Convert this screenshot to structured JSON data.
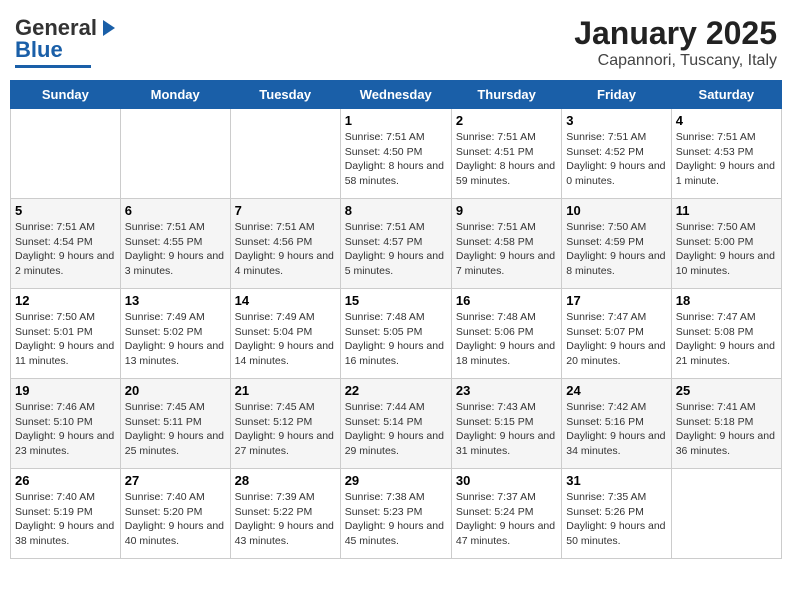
{
  "header": {
    "logo_general": "General",
    "logo_blue": "Blue",
    "title": "January 2025",
    "subtitle": "Capannori, Tuscany, Italy"
  },
  "days_of_week": [
    "Sunday",
    "Monday",
    "Tuesday",
    "Wednesday",
    "Thursday",
    "Friday",
    "Saturday"
  ],
  "weeks": [
    [
      {
        "day": "",
        "sunrise": "",
        "sunset": "",
        "daylight": ""
      },
      {
        "day": "",
        "sunrise": "",
        "sunset": "",
        "daylight": ""
      },
      {
        "day": "",
        "sunrise": "",
        "sunset": "",
        "daylight": ""
      },
      {
        "day": "1",
        "sunrise": "Sunrise: 7:51 AM",
        "sunset": "Sunset: 4:50 PM",
        "daylight": "Daylight: 8 hours and 58 minutes."
      },
      {
        "day": "2",
        "sunrise": "Sunrise: 7:51 AM",
        "sunset": "Sunset: 4:51 PM",
        "daylight": "Daylight: 8 hours and 59 minutes."
      },
      {
        "day": "3",
        "sunrise": "Sunrise: 7:51 AM",
        "sunset": "Sunset: 4:52 PM",
        "daylight": "Daylight: 9 hours and 0 minutes."
      },
      {
        "day": "4",
        "sunrise": "Sunrise: 7:51 AM",
        "sunset": "Sunset: 4:53 PM",
        "daylight": "Daylight: 9 hours and 1 minute."
      }
    ],
    [
      {
        "day": "5",
        "sunrise": "Sunrise: 7:51 AM",
        "sunset": "Sunset: 4:54 PM",
        "daylight": "Daylight: 9 hours and 2 minutes."
      },
      {
        "day": "6",
        "sunrise": "Sunrise: 7:51 AM",
        "sunset": "Sunset: 4:55 PM",
        "daylight": "Daylight: 9 hours and 3 minutes."
      },
      {
        "day": "7",
        "sunrise": "Sunrise: 7:51 AM",
        "sunset": "Sunset: 4:56 PM",
        "daylight": "Daylight: 9 hours and 4 minutes."
      },
      {
        "day": "8",
        "sunrise": "Sunrise: 7:51 AM",
        "sunset": "Sunset: 4:57 PM",
        "daylight": "Daylight: 9 hours and 5 minutes."
      },
      {
        "day": "9",
        "sunrise": "Sunrise: 7:51 AM",
        "sunset": "Sunset: 4:58 PM",
        "daylight": "Daylight: 9 hours and 7 minutes."
      },
      {
        "day": "10",
        "sunrise": "Sunrise: 7:50 AM",
        "sunset": "Sunset: 4:59 PM",
        "daylight": "Daylight: 9 hours and 8 minutes."
      },
      {
        "day": "11",
        "sunrise": "Sunrise: 7:50 AM",
        "sunset": "Sunset: 5:00 PM",
        "daylight": "Daylight: 9 hours and 10 minutes."
      }
    ],
    [
      {
        "day": "12",
        "sunrise": "Sunrise: 7:50 AM",
        "sunset": "Sunset: 5:01 PM",
        "daylight": "Daylight: 9 hours and 11 minutes."
      },
      {
        "day": "13",
        "sunrise": "Sunrise: 7:49 AM",
        "sunset": "Sunset: 5:02 PM",
        "daylight": "Daylight: 9 hours and 13 minutes."
      },
      {
        "day": "14",
        "sunrise": "Sunrise: 7:49 AM",
        "sunset": "Sunset: 5:04 PM",
        "daylight": "Daylight: 9 hours and 14 minutes."
      },
      {
        "day": "15",
        "sunrise": "Sunrise: 7:48 AM",
        "sunset": "Sunset: 5:05 PM",
        "daylight": "Daylight: 9 hours and 16 minutes."
      },
      {
        "day": "16",
        "sunrise": "Sunrise: 7:48 AM",
        "sunset": "Sunset: 5:06 PM",
        "daylight": "Daylight: 9 hours and 18 minutes."
      },
      {
        "day": "17",
        "sunrise": "Sunrise: 7:47 AM",
        "sunset": "Sunset: 5:07 PM",
        "daylight": "Daylight: 9 hours and 20 minutes."
      },
      {
        "day": "18",
        "sunrise": "Sunrise: 7:47 AM",
        "sunset": "Sunset: 5:08 PM",
        "daylight": "Daylight: 9 hours and 21 minutes."
      }
    ],
    [
      {
        "day": "19",
        "sunrise": "Sunrise: 7:46 AM",
        "sunset": "Sunset: 5:10 PM",
        "daylight": "Daylight: 9 hours and 23 minutes."
      },
      {
        "day": "20",
        "sunrise": "Sunrise: 7:45 AM",
        "sunset": "Sunset: 5:11 PM",
        "daylight": "Daylight: 9 hours and 25 minutes."
      },
      {
        "day": "21",
        "sunrise": "Sunrise: 7:45 AM",
        "sunset": "Sunset: 5:12 PM",
        "daylight": "Daylight: 9 hours and 27 minutes."
      },
      {
        "day": "22",
        "sunrise": "Sunrise: 7:44 AM",
        "sunset": "Sunset: 5:14 PM",
        "daylight": "Daylight: 9 hours and 29 minutes."
      },
      {
        "day": "23",
        "sunrise": "Sunrise: 7:43 AM",
        "sunset": "Sunset: 5:15 PM",
        "daylight": "Daylight: 9 hours and 31 minutes."
      },
      {
        "day": "24",
        "sunrise": "Sunrise: 7:42 AM",
        "sunset": "Sunset: 5:16 PM",
        "daylight": "Daylight: 9 hours and 34 minutes."
      },
      {
        "day": "25",
        "sunrise": "Sunrise: 7:41 AM",
        "sunset": "Sunset: 5:18 PM",
        "daylight": "Daylight: 9 hours and 36 minutes."
      }
    ],
    [
      {
        "day": "26",
        "sunrise": "Sunrise: 7:40 AM",
        "sunset": "Sunset: 5:19 PM",
        "daylight": "Daylight: 9 hours and 38 minutes."
      },
      {
        "day": "27",
        "sunrise": "Sunrise: 7:40 AM",
        "sunset": "Sunset: 5:20 PM",
        "daylight": "Daylight: 9 hours and 40 minutes."
      },
      {
        "day": "28",
        "sunrise": "Sunrise: 7:39 AM",
        "sunset": "Sunset: 5:22 PM",
        "daylight": "Daylight: 9 hours and 43 minutes."
      },
      {
        "day": "29",
        "sunrise": "Sunrise: 7:38 AM",
        "sunset": "Sunset: 5:23 PM",
        "daylight": "Daylight: 9 hours and 45 minutes."
      },
      {
        "day": "30",
        "sunrise": "Sunrise: 7:37 AM",
        "sunset": "Sunset: 5:24 PM",
        "daylight": "Daylight: 9 hours and 47 minutes."
      },
      {
        "day": "31",
        "sunrise": "Sunrise: 7:35 AM",
        "sunset": "Sunset: 5:26 PM",
        "daylight": "Daylight: 9 hours and 50 minutes."
      },
      {
        "day": "",
        "sunrise": "",
        "sunset": "",
        "daylight": ""
      }
    ]
  ]
}
